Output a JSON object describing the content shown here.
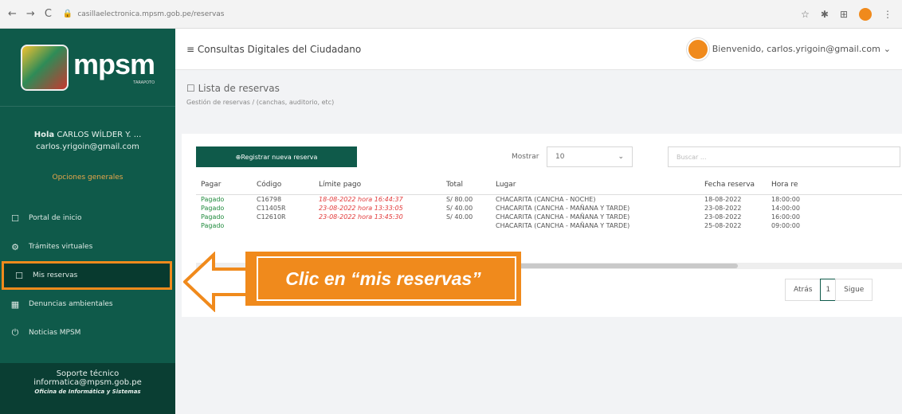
{
  "browser": {
    "url": "casillaelectronica.mpsm.gob.pe/reservas"
  },
  "sidebar": {
    "brand": "mpsm",
    "brand_sub": "TARAPOTO",
    "hello_prefix": "Hola",
    "user_name": "CARLOS WÍLDER Y. ...",
    "email": "carlos.yrigoin@gmail.com",
    "section_title": "Opciones generales",
    "items": [
      {
        "label": "Portal de inicio",
        "icon": "window-icon"
      },
      {
        "label": "Trámites virtuales",
        "icon": "gear-icon"
      },
      {
        "label": "Mis reservas",
        "icon": "square-icon"
      },
      {
        "label": "Denuncias ambientales",
        "icon": "building-icon"
      },
      {
        "label": "Noticias MPSM",
        "icon": "power-icon"
      }
    ],
    "support_title": "Soporte técnico",
    "support_email": "informatica@mpsm.gob.pe",
    "support_office": "Oficina de Informática y Sistemas"
  },
  "header": {
    "title": "Consultas Digitales del Ciudadano",
    "welcome": "Bienvenido, carlos.yrigoin@gmail.com"
  },
  "page": {
    "title": "Lista de reservas",
    "breadcrumb_1": "Gestión de reservas",
    "breadcrumb_2": "(canchas, auditorio, etc)"
  },
  "toolbar": {
    "new_label": "Registrar nueva reserva",
    "show_label": "Mostrar",
    "show_value": "10",
    "search_placeholder": "Buscar ..."
  },
  "table": {
    "columns": [
      "Pagar",
      "Código",
      "Límite pago",
      "Total",
      "Lugar",
      "Fecha reserva",
      "Hora re"
    ],
    "rows": [
      [
        "Pagado",
        "C16798",
        "18-08-2022 hora 16:44:37",
        "S/ 80.00",
        "CHACARITA (CANCHA - NOCHE)",
        "18-08-2022",
        "18:00:00"
      ],
      [
        "Pagado",
        "C11405R",
        "23-08-2022 hora 13:33:05",
        "S/ 40.00",
        "CHACARITA (CANCHA - MAÑANA Y TARDE)",
        "23-08-2022",
        "14:00:00"
      ],
      [
        "Pagado",
        "C12610R",
        "23-08-2022 hora 13:45:30",
        "S/ 40.00",
        "CHACARITA (CANCHA - MAÑANA Y TARDE)",
        "23-08-2022",
        "16:00:00"
      ],
      [
        "Pagado",
        "",
        "",
        "",
        "CHACARITA (CANCHA - MAÑANA Y TARDE)",
        "25-08-2022",
        "09:00:00"
      ]
    ]
  },
  "pager": {
    "prev": "Atrás",
    "current": "1",
    "next": "Sigue"
  },
  "annotation": {
    "text": "Clic en “mis reservas”",
    "color": "#f08a1c"
  }
}
